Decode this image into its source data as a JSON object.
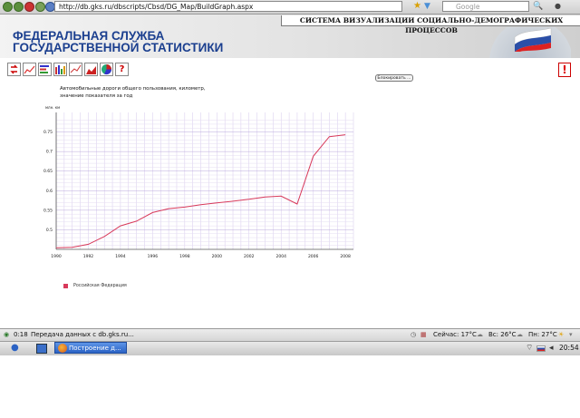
{
  "browser": {
    "url": "http://db.gks.ru/dbscripts/Cbsd/DG_Map/BuildGraph.aspx",
    "search_placeholder": "Google"
  },
  "header": {
    "system_title": "СИСТЕМА ВИЗУАЛИЗАЦИИ СОЦИАЛЬНО-ДЕМОГРАФИЧЕСКИХ ПРОЦЕССОВ",
    "org_line1": "ФЕДЕРАЛЬНАЯ СЛУЖБА",
    "org_line2": "ГОСУДАРСТВЕННОЙ СТАТИСТИКИ"
  },
  "toolbar": {
    "block_label": "Блокировать ...",
    "alert_label": "!",
    "help_label": "?"
  },
  "chart_data": {
    "type": "line",
    "title_line1": "Автомобильные дороги общего пользования, километр,",
    "title_line2": "значение показателя за год",
    "ylabel": "млн. км",
    "x": [
      1990,
      1991,
      1992,
      1993,
      1994,
      1995,
      1996,
      1997,
      1998,
      1999,
      2000,
      2001,
      2002,
      2003,
      2004,
      2005,
      2006,
      2007,
      2008
    ],
    "x_ticks": [
      "1990",
      "1992",
      "1994",
      "1996",
      "1998",
      "2000",
      "2002",
      "2004",
      "2006",
      "2008"
    ],
    "y_ticks": [
      "0.5",
      "0.55",
      "0.6",
      "0.65",
      "0.7",
      "0.75"
    ],
    "ylim": [
      0.45,
      0.8
    ],
    "series": [
      {
        "name": "Российская Федерация",
        "color": "#d83a5b",
        "values": [
          0.454,
          0.455,
          0.463,
          0.483,
          0.51,
          0.522,
          0.544,
          0.554,
          0.558,
          0.564,
          0.569,
          0.573,
          0.578,
          0.584,
          0.586,
          0.566,
          0.688,
          0.738,
          0.743
        ]
      }
    ],
    "grid": true,
    "legend_position": "bottom-left"
  },
  "status": {
    "time": "0:18",
    "message": "Передача данных с db.gks.ru...",
    "weather_now": "Сейчас: 17°C",
    "weather_sun": "Вс: 26°C",
    "weather_mon": "Пн: 27°C"
  },
  "taskbar": {
    "task_label": "Построение д...",
    "clock": "20:54"
  }
}
